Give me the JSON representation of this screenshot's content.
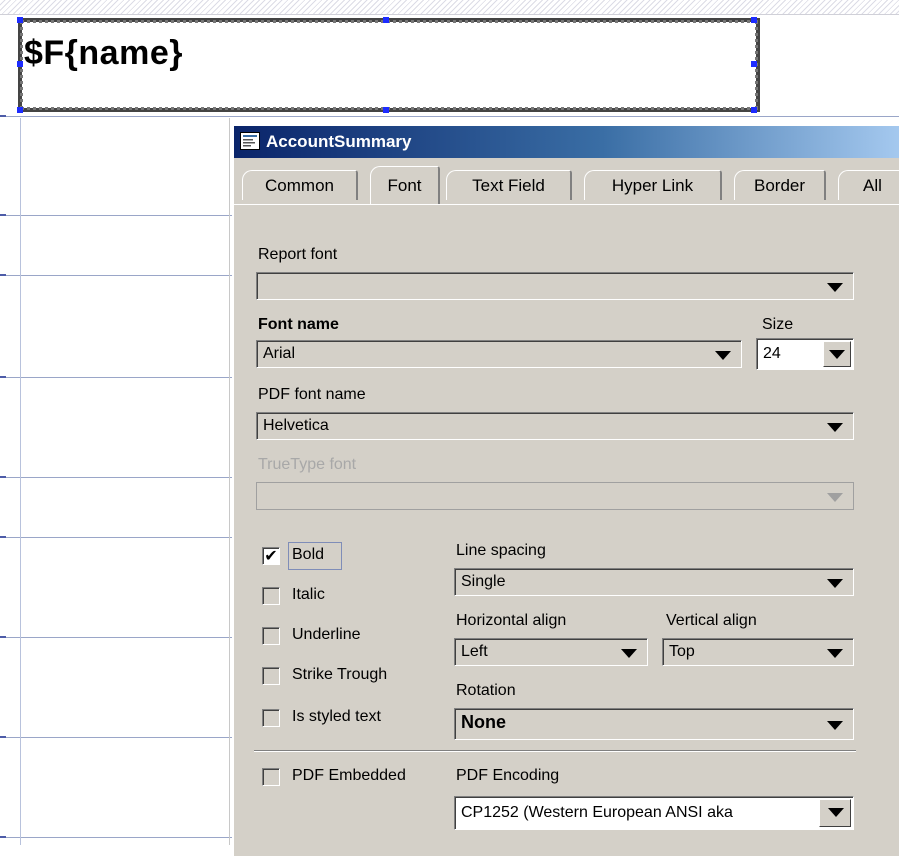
{
  "canvas": {
    "field_expression": "$F{name}"
  },
  "dialog": {
    "title": "AccountSummary",
    "tabs": [
      "Common",
      "Font",
      "Text Field",
      "Hyper Link",
      "Border",
      "All"
    ],
    "active_tab": "Font",
    "report_font": {
      "label": "Report font",
      "value": ""
    },
    "font_name": {
      "label": "Font name",
      "value": "Arial"
    },
    "size": {
      "label": "Size",
      "value": "24"
    },
    "pdf_font_name": {
      "label": "PDF font name",
      "value": "Helvetica"
    },
    "truetype_font": {
      "label": "TrueType font",
      "value": "",
      "enabled": false
    },
    "checkboxes": [
      {
        "label": "Bold",
        "checked": true
      },
      {
        "label": "Italic",
        "checked": false
      },
      {
        "label": "Underline",
        "checked": false
      },
      {
        "label": "Strike Trough",
        "checked": false
      },
      {
        "label": "Is styled text",
        "checked": false
      }
    ],
    "line_spacing": {
      "label": "Line spacing",
      "value": "Single"
    },
    "horizontal_align": {
      "label": "Horizontal align",
      "value": "Left"
    },
    "vertical_align": {
      "label": "Vertical align",
      "value": "Top"
    },
    "rotation": {
      "label": "Rotation",
      "value": "None"
    },
    "pdf_embedded": {
      "label": "PDF Embedded",
      "checked": false
    },
    "pdf_encoding": {
      "label": "PDF Encoding",
      "value": "CP1252 (Western European ANSI aka"
    }
  },
  "colors": {
    "titlebar_start": "#0a246a",
    "titlebar_end": "#a6caf0",
    "dialog_bg": "#d4d0c8",
    "selection_handle": "#1d2cff"
  }
}
